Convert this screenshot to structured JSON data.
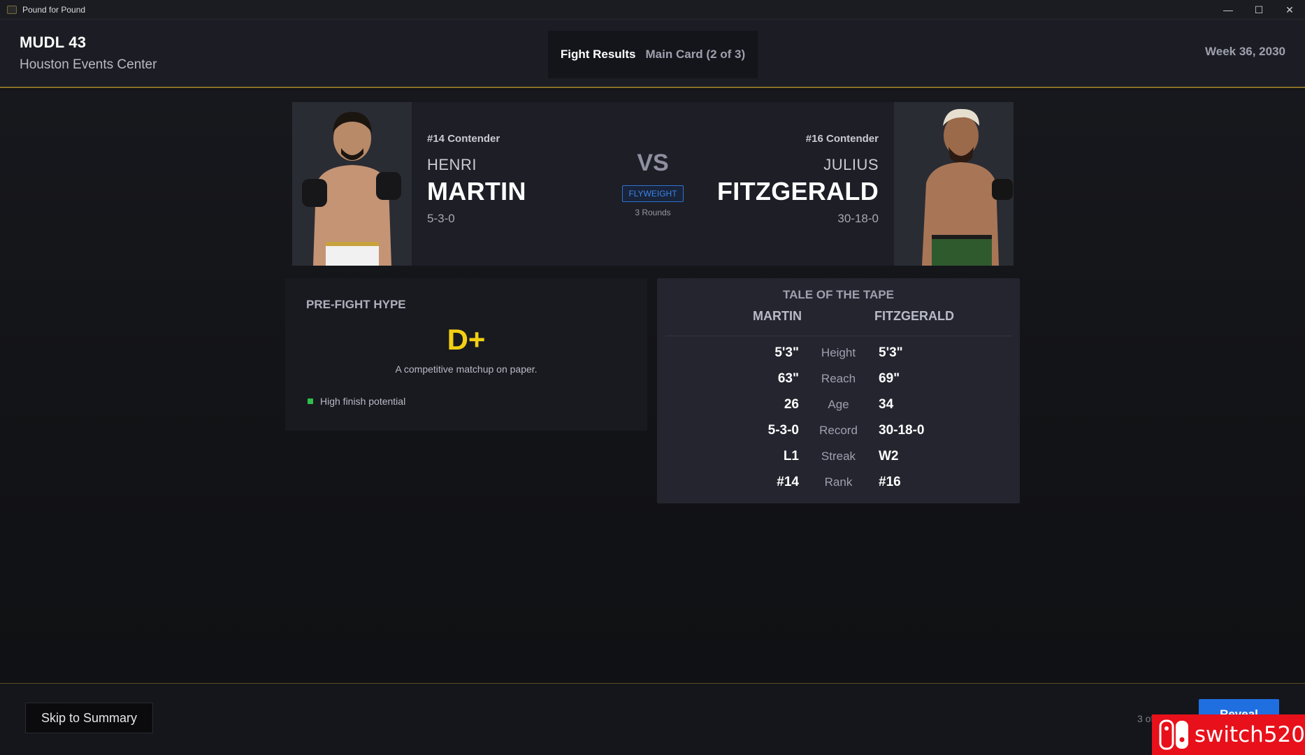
{
  "window": {
    "title": "Pound for Pound",
    "controls": [
      "—",
      "☐",
      "✕"
    ]
  },
  "header": {
    "event_name": "MUDL 43",
    "venue": "Houston Events Center",
    "section_title": "Fight Results",
    "section_sub": "Main Card (2 of 3)",
    "week": "Week 36, 2030"
  },
  "matchup": {
    "left": {
      "rank": "#14 Contender",
      "first_name": "HENRI",
      "last_name": "MARTIN",
      "record": "5-3-0"
    },
    "right": {
      "rank": "#16 Contender",
      "first_name": "JULIUS",
      "last_name": "FITZGERALD",
      "record": "30-18-0"
    },
    "vs": "VS",
    "weight_class": "FLYWEIGHT",
    "rounds": "3 Rounds"
  },
  "hype": {
    "title": "PRE-FIGHT HYPE",
    "grade": "D+",
    "description": "A competitive matchup on paper.",
    "bullets": [
      "High finish potential"
    ]
  },
  "tape": {
    "title": "TALE OF THE TAPE",
    "left_name": "MARTIN",
    "right_name": "FITZGERALD",
    "rows": [
      {
        "left": "5'3\"",
        "stat": "Height",
        "right": "5'3\""
      },
      {
        "left": "63\"",
        "stat": "Reach",
        "right": "69\""
      },
      {
        "left": "26",
        "stat": "Age",
        "right": "34"
      },
      {
        "left": "5-3-0",
        "stat": "Record",
        "right": "30-18-0"
      },
      {
        "left": "L1",
        "stat": "Streak",
        "right": "W2"
      },
      {
        "left": "#14",
        "stat": "Rank",
        "right": "#16"
      }
    ]
  },
  "footer": {
    "skip_label": "Skip to Summary",
    "page_count": "3 of 11",
    "reveal_label": "Reveal"
  },
  "watermark": {
    "text": "switch520"
  },
  "colors": {
    "accent_gold": "#8a7128",
    "grade_yellow": "#f2d011",
    "weight_blue": "#2f74d0",
    "reveal_blue": "#1f6fe0",
    "bullet_green": "#2fbf4a",
    "watermark_red": "#e8101a"
  }
}
